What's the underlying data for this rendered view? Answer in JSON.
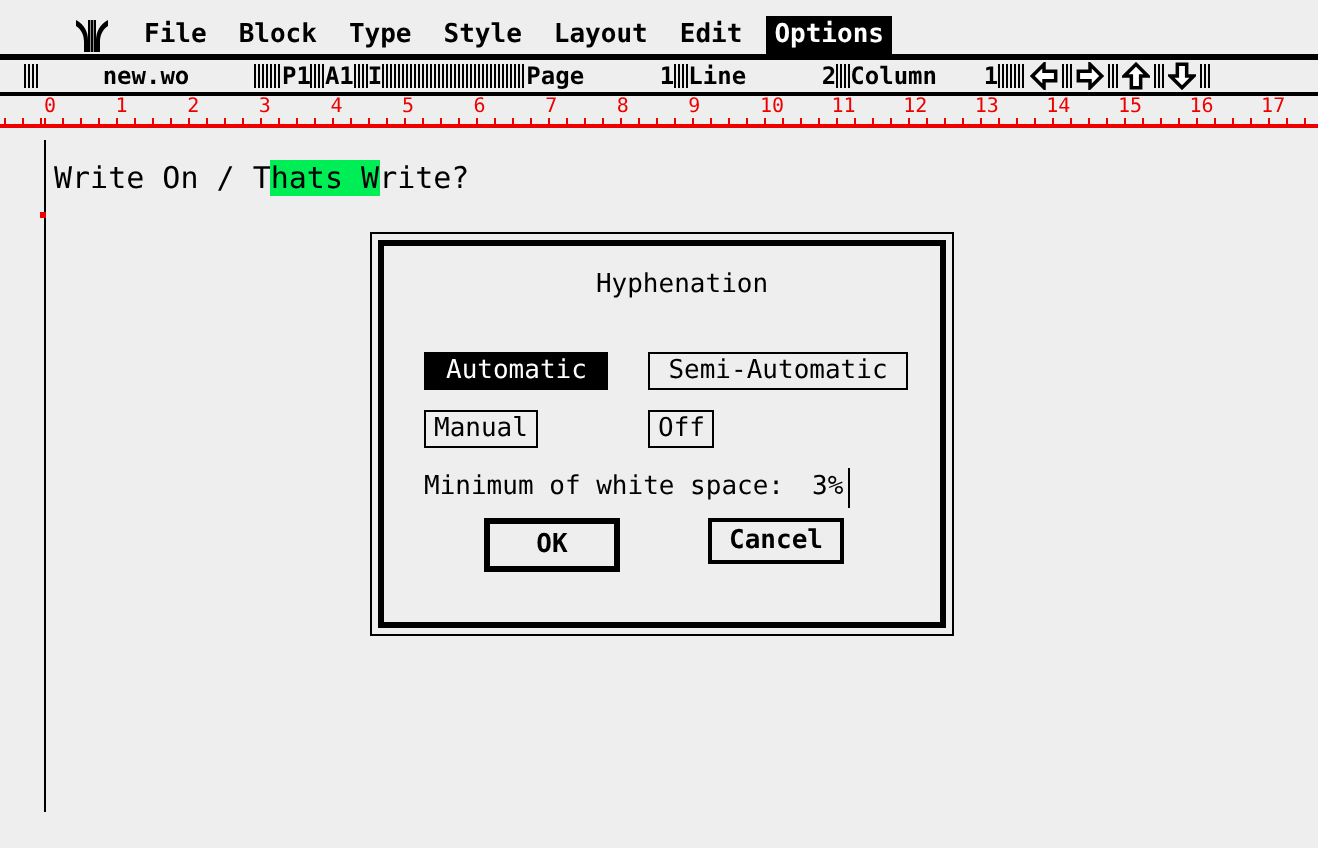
{
  "menu_bar": {
    "items": [
      {
        "label": "File",
        "selected": false
      },
      {
        "label": "Block",
        "selected": false
      },
      {
        "label": "Type",
        "selected": false
      },
      {
        "label": "Style",
        "selected": false
      },
      {
        "label": "Layout",
        "selected": false
      },
      {
        "label": "Edit",
        "selected": false
      },
      {
        "label": "Options",
        "selected": true
      }
    ]
  },
  "status_bar": {
    "file_name": "new.wo",
    "fields": [
      "P1",
      "A1",
      "I"
    ],
    "counters": [
      {
        "value": "1",
        "label": "Page"
      },
      {
        "value": "2",
        "label": "Line"
      },
      {
        "value": "1",
        "label": "Column"
      }
    ]
  },
  "ruler": {
    "numbers": [
      "0",
      "1",
      "2",
      "3",
      "4",
      "5",
      "6",
      "7",
      "8",
      "9",
      "10",
      "11",
      "12",
      "13",
      "14",
      "15",
      "16",
      "17"
    ]
  },
  "document": {
    "segments": [
      {
        "text": "Write On / T",
        "selected": false
      },
      {
        "text": "hats W",
        "selected": true
      },
      {
        "text": "rite?",
        "selected": false
      }
    ]
  },
  "dialog": {
    "title": "Hyphenation",
    "options": [
      {
        "label": "Automatic",
        "selected": true
      },
      {
        "label": "Semi-Automatic",
        "selected": false
      },
      {
        "label": "Manual",
        "selected": false
      },
      {
        "label": "Off",
        "selected": false
      }
    ],
    "field": {
      "label": "Minimum of white space:",
      "value": "3%"
    },
    "buttons": [
      {
        "label": "OK",
        "kind": "default"
      },
      {
        "label": "Cancel",
        "kind": "normal"
      }
    ]
  }
}
